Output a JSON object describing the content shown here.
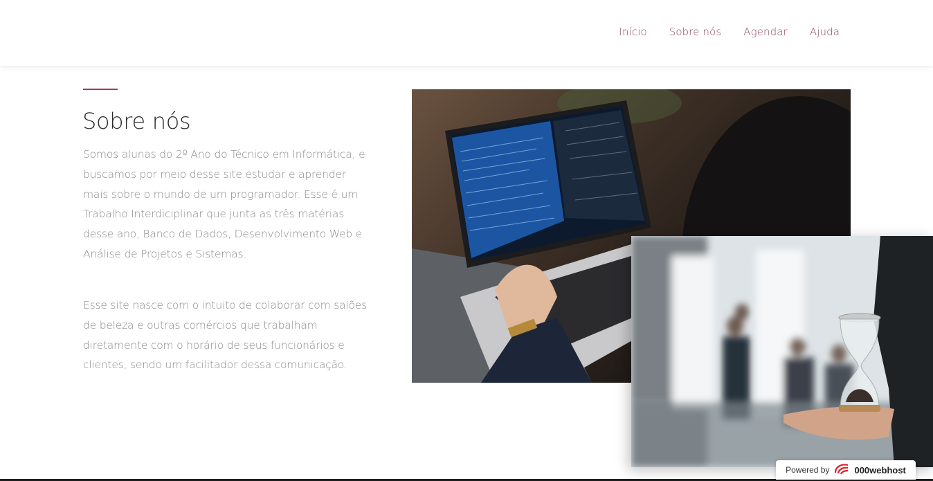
{
  "nav": {
    "items": [
      {
        "label": "Início"
      },
      {
        "label": "Sobre nós"
      },
      {
        "label": "Agendar"
      },
      {
        "label": "Ajuda"
      }
    ]
  },
  "about": {
    "title": "Sobre nós",
    "paragraph1": "Somos alunas do 2º Ano do Técnico em Informática, e buscamos por meio desse site estudar e aprender mais sobre o mundo de um programador. Esse é um Trabalho Interdiciplinar que junta as três matérias desse ano, Banco de Dados, Desenvolvimento Web e Análise de Projetos e Sistemas.",
    "paragraph2": "Esse site nasce com o intuito de colaborar com salões de beleza e outras comércios que trabalham diretamente com o horário de seus funcionários e clientes, sendo um facilitador dessa comunicação."
  },
  "badge": {
    "powered_by": "Powered by",
    "brand": "000webhost",
    "icon": "000webhost-logo-icon"
  },
  "colors": {
    "accent": "#9b3e5c",
    "nav_link": "#8e4b6a",
    "body_text": "#8a8a8a",
    "title_text": "#2b2b2b"
  }
}
